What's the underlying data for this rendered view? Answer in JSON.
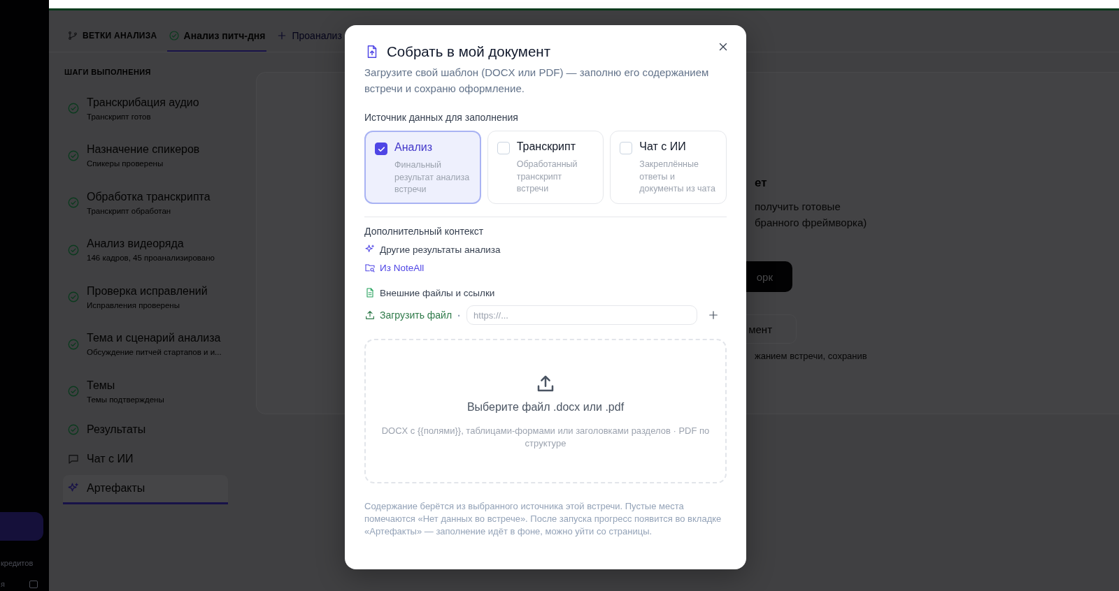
{
  "sidebar": {
    "footer_text": "кредитов",
    "footer_text_2": "я"
  },
  "tabs": [
    {
      "kind": "header",
      "label": "ВЕТКИ АНАЛИЗА",
      "selected": false
    },
    {
      "kind": "done",
      "label": "Анализ питч-дня",
      "selected": true
    },
    {
      "kind": "add",
      "label": "Проанализ",
      "selected": false
    }
  ],
  "steps_header": "ШАГИ ВЫПОЛНЕНИЯ",
  "steps": [
    {
      "kind": "done",
      "title": "Транскрибация аудио",
      "subtitle": "Транскрипт готов",
      "selected": false
    },
    {
      "kind": "done",
      "title": "Назначение спикеров",
      "subtitle": "Спикеры проверены",
      "selected": false
    },
    {
      "kind": "done",
      "title": "Обработка транскрипта",
      "subtitle": "Транскрипт обработан",
      "selected": false
    },
    {
      "kind": "done",
      "title": "Анализ видеоряда",
      "subtitle": "146 кадров, 45 проанализировано",
      "selected": false
    },
    {
      "kind": "done",
      "title": "Проверка исправлений",
      "subtitle": "Исправления проверены",
      "selected": false
    },
    {
      "kind": "done",
      "title": "Тема и сценарий анализа",
      "subtitle": "Обсуждение питчей стартапов и и...",
      "selected": false
    },
    {
      "kind": "done",
      "title": "Темы",
      "subtitle": "Темы подтверждены",
      "selected": false
    },
    {
      "kind": "done",
      "title": "Результаты",
      "selected": false
    },
    {
      "kind": "chat",
      "title": "Чат с ИИ",
      "selected": false
    },
    {
      "kind": "artifacts",
      "title": "Артефакты",
      "selected": true
    }
  ],
  "background_card": {
    "heading": "ет",
    "lines": [
      "получить готовые",
      "бранного фреймворка)"
    ],
    "primary_button": "орк",
    "secondary_button": "мент",
    "note": "жанием встречи, сохранив"
  },
  "modal": {
    "title": "Собрать в мой документ",
    "subtitle": "Загрузите свой шаблон (DOCX или PDF) — заполню его содержанием встречи и сохраню оформление.",
    "source_label": "Источник данных для заполнения",
    "sources": [
      {
        "title": "Анализ",
        "description": "Финальный результат анализа встречи",
        "selected": true
      },
      {
        "title": "Транскрипт",
        "description": "Обработанный транскрипт встречи",
        "selected": false
      },
      {
        "title": "Чат с ИИ",
        "description": "Закреплённые ответы и документы из чата",
        "selected": false
      }
    ],
    "context_label": "Дополнительный контекст",
    "context_items": [
      {
        "kind": "analysis",
        "label": "Другие результаты анализа"
      },
      {
        "kind": "noteall",
        "label": "Из NoteAll"
      }
    ],
    "external_label": "Внешние файлы и ссылки",
    "upload_button": "Загрузить файл",
    "separator": "·",
    "url_field": {
      "placeholder": "https://..."
    },
    "dropzone": {
      "title": "Выберите файл .docx или .pdf",
      "hint": "DOCX с {{полями}}, таблицами-формами или заголовками разделов · PDF по структуре"
    },
    "note": "Содержание берётся из выбранного источника этой встречи. Пустые места помечаются «Нет данных во встрече». После запуска прогресс появится во вкладке «Артефакты» — заполнение идёт в фоне, можно уйти со страницы."
  }
}
